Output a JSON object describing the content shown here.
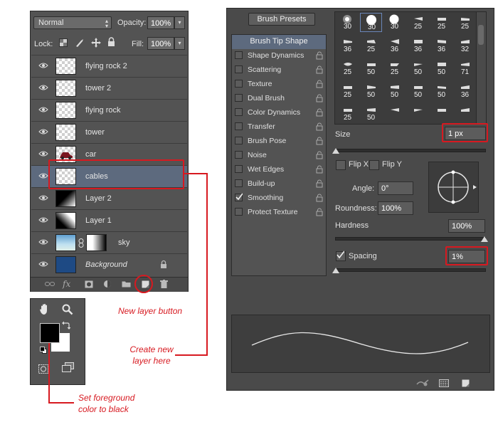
{
  "layers_panel": {
    "blend_mode": "Normal",
    "opacity_label": "Opacity:",
    "opacity_value": "100%",
    "lock_label": "Lock:",
    "fill_label": "Fill:",
    "fill_value": "100%",
    "layers": [
      {
        "name": "flying rock 2",
        "thumb": "transparent"
      },
      {
        "name": "tower 2",
        "thumb": "transparent"
      },
      {
        "name": "flying rock",
        "thumb": "transparent"
      },
      {
        "name": "tower",
        "thumb": "transparent"
      },
      {
        "name": "car",
        "thumb": "car"
      },
      {
        "name": "cables",
        "thumb": "transparent",
        "selected": true
      },
      {
        "name": "Layer 2",
        "thumb": "gradient-dark"
      },
      {
        "name": "Layer 1",
        "thumb": "gradient-light"
      },
      {
        "name": "sky",
        "thumb": "sky-mask"
      },
      {
        "name": "Background",
        "thumb": "blue",
        "locked": true
      }
    ]
  },
  "brush_panel": {
    "presets_button": "Brush Presets",
    "tip_shape_button": "Brush Tip Shape",
    "options": [
      {
        "label": "Shape Dynamics",
        "checked": false
      },
      {
        "label": "Scattering",
        "checked": false
      },
      {
        "label": "Texture",
        "checked": false
      },
      {
        "label": "Dual Brush",
        "checked": false
      },
      {
        "label": "Color Dynamics",
        "checked": false
      },
      {
        "label": "Transfer",
        "checked": false
      },
      {
        "label": "Brush Pose",
        "checked": false
      },
      {
        "label": "Noise",
        "checked": false
      },
      {
        "label": "Wet Edges",
        "checked": false
      },
      {
        "label": "Build-up",
        "checked": false
      },
      {
        "label": "Smoothing",
        "checked": true
      },
      {
        "label": "Protect Texture",
        "checked": false
      }
    ],
    "brush_sizes": [
      [
        "30",
        "30",
        "30",
        "25",
        "25",
        "25"
      ],
      [
        "36",
        "25",
        "36",
        "36",
        "36",
        "32"
      ],
      [
        "25",
        "50",
        "25",
        "50",
        "50",
        "71"
      ],
      [
        "25",
        "50",
        "50",
        "50",
        "50",
        "36"
      ],
      [
        "25",
        "50",
        "",
        "",
        "",
        ""
      ]
    ],
    "size_label": "Size",
    "size_value": "1 px",
    "flip_x_label": "Flip X",
    "flip_y_label": "Flip Y",
    "angle_label": "Angle:",
    "angle_value": "0°",
    "roundness_label": "Roundness:",
    "roundness_value": "100%",
    "hardness_label": "Hardness",
    "hardness_value": "100%",
    "spacing_label": "Spacing",
    "spacing_checked": true,
    "spacing_value": "1%"
  },
  "annotations": {
    "new_layer_button": "New layer button",
    "create_new_layer": "Create new\nlayer here",
    "set_foreground": "Set foreground\ncolor to black"
  },
  "colors": {
    "annotation_red": "#d71920",
    "selected_layer": "#5d6a7e",
    "background_layer_blue": "#1e4a84",
    "foreground": "#000000",
    "background": "#ffffff"
  }
}
